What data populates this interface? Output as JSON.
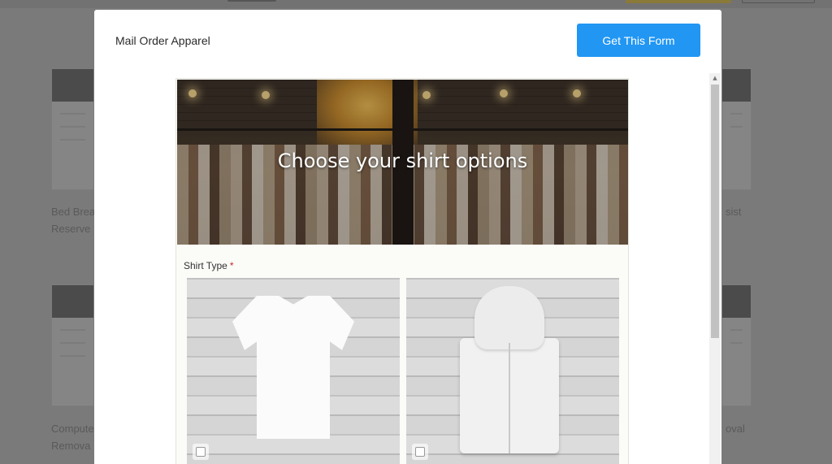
{
  "modal": {
    "title": "Mail Order Apparel",
    "get_form_label": "Get This Form"
  },
  "form": {
    "hero_heading": "Choose your shirt options",
    "shirt_type_label": "Shirt Type",
    "required_marker": "*",
    "options": [
      {
        "image": "white-tshirt",
        "checked": false
      },
      {
        "image": "white-hoodie",
        "checked": false
      }
    ]
  },
  "background": {
    "texts": [
      {
        "id": "a1",
        "text": "Bed Brea"
      },
      {
        "id": "a2",
        "text": "Reserve"
      },
      {
        "id": "b1",
        "text": "Compute"
      },
      {
        "id": "b2",
        "text": "Remova"
      },
      {
        "id": "c1",
        "text": "sist"
      },
      {
        "id": "d1",
        "text": "oval"
      }
    ]
  },
  "colors": {
    "accent": "#2196f3",
    "required": "#c62828",
    "overlay": "#7a7a7a"
  },
  "icons": {
    "scroll_up": "scroll-up-arrow-icon",
    "scroll_down": "scroll-down-arrow-icon",
    "checkbox": "checkbox-icon"
  }
}
